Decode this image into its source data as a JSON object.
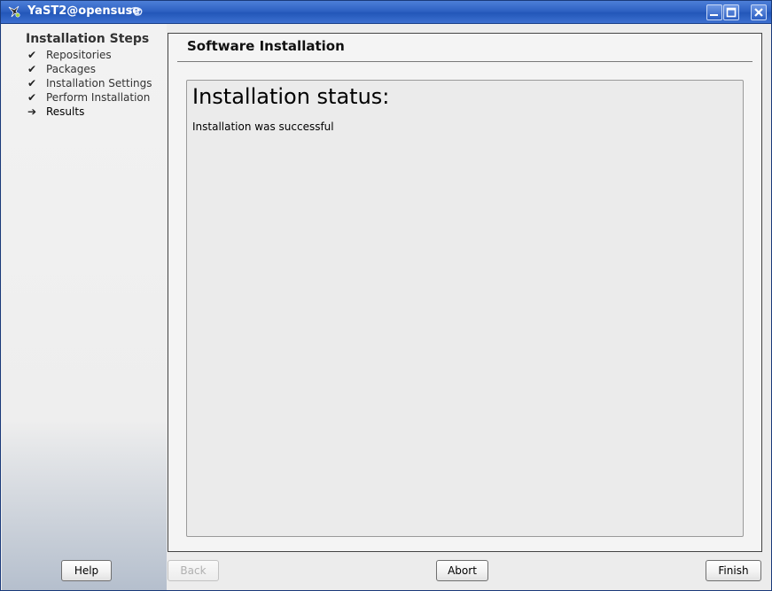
{
  "window": {
    "title": "YaST2@opensuse",
    "accent": "#2f62c3"
  },
  "titlebar_buttons": [
    "minimize",
    "maximize",
    "close"
  ],
  "sidebar": {
    "heading": "Installation Steps",
    "steps": [
      {
        "label": "Repositories",
        "mark": "✔",
        "state": "done"
      },
      {
        "label": "Packages",
        "mark": "✔",
        "state": "done"
      },
      {
        "label": "Installation Settings",
        "mark": "✔",
        "state": "done"
      },
      {
        "label": "Perform Installation",
        "mark": "✔",
        "state": "done"
      },
      {
        "label": "Results",
        "mark": "➔",
        "state": "current"
      }
    ]
  },
  "main": {
    "title": "Software Installation",
    "status_heading": "Installation status:",
    "status_message": "Installation was successful"
  },
  "buttons": {
    "help": {
      "label": "Help",
      "enabled": true
    },
    "back": {
      "label": "Back",
      "enabled": false
    },
    "abort": {
      "label": "Abort",
      "enabled": true
    },
    "finish": {
      "label": "Finish",
      "enabled": true
    }
  }
}
